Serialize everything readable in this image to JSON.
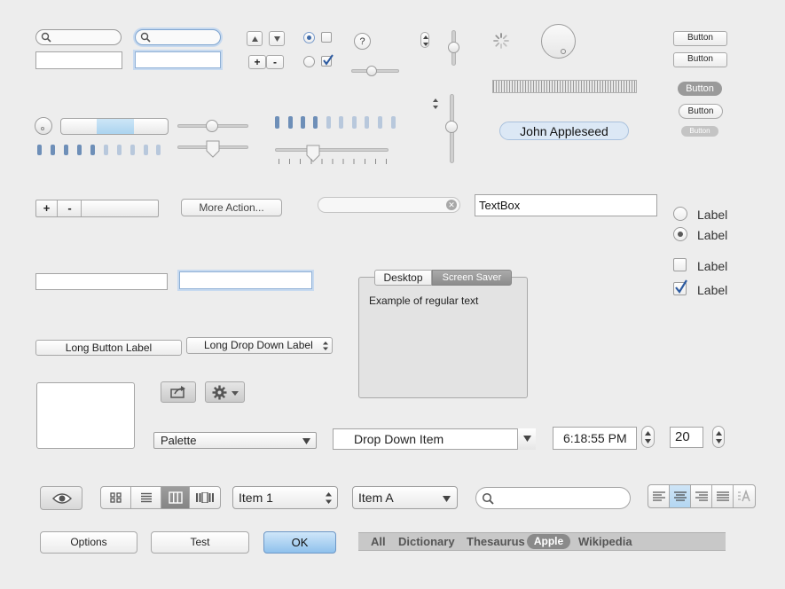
{
  "buttons": {
    "button_1": "Button",
    "button_2": "Button",
    "button_3": "Button",
    "button_4": "Button",
    "button_5": "Button",
    "more_action": "More Action...",
    "long_button": "Long Button Label",
    "long_dropdown": "Long Drop Down Label",
    "options": "Options",
    "test": "Test",
    "ok": "OK",
    "plus": "+",
    "minus": "-"
  },
  "token": "John Appleseed",
  "textbox": {
    "value": "TextBox"
  },
  "radios": [
    {
      "label": "Label",
      "selected": false
    },
    {
      "label": "Label",
      "selected": true
    }
  ],
  "checkboxes": [
    {
      "label": "Label",
      "checked": false
    },
    {
      "label": "Label",
      "checked": true
    }
  ],
  "tabview": {
    "tabs": [
      "Desktop",
      "Screen Saver"
    ],
    "selected": "Screen Saver",
    "content": "Example of regular text"
  },
  "popups": {
    "palette": "Palette",
    "drop_down_item": "Drop Down Item",
    "item1": "Item 1",
    "itemA": "Item A"
  },
  "time": "6:18:55 PM",
  "stepper_value": "20",
  "scope_bar": {
    "items": [
      "All",
      "Dictionary",
      "Thesaurus",
      "Apple",
      "Wikipedia"
    ],
    "selected": "Apple"
  },
  "colors": {
    "accent": "#6e8fb8",
    "focus": "#8fb0d6",
    "ok_button": "#a9d0f0"
  }
}
